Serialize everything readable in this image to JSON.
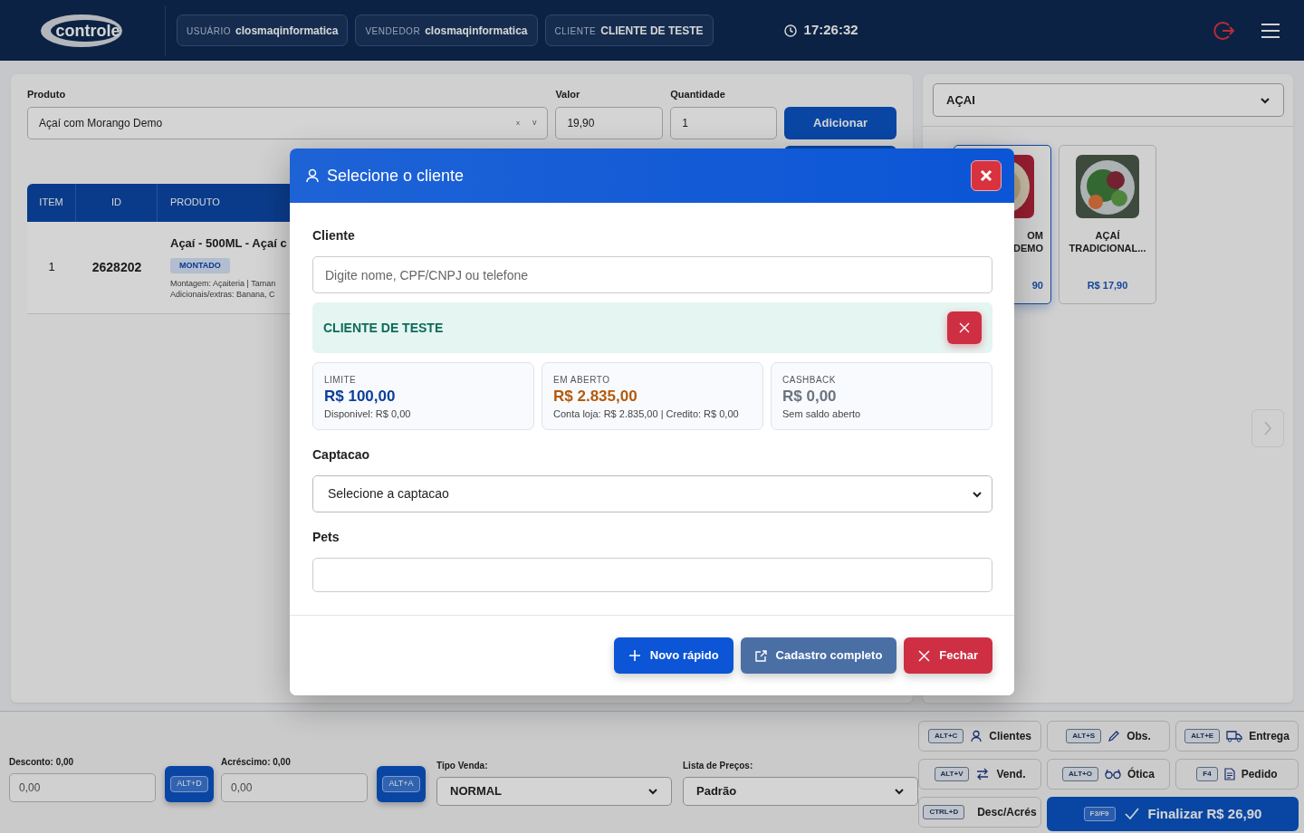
{
  "header": {
    "logo_text": "controle",
    "chips": [
      {
        "label": "USUÁRIO",
        "value": "closmaqinformatica"
      },
      {
        "label": "VENDEDOR",
        "value": "closmaqinformatica"
      },
      {
        "label": "CLIENTE",
        "value": "CLIENTE DE TESTE"
      }
    ],
    "clock": "17:26:32"
  },
  "product_form": {
    "produto_label": "Produto",
    "produto_value": "Açaí com Morango Demo",
    "clear_glyph": "x",
    "caret_glyph": "v",
    "valor_label": "Valor",
    "valor_value": "19,90",
    "quantidade_label": "Quantidade",
    "quantidade_value": "1",
    "add_button": "Adicionar"
  },
  "items_table": {
    "columns": [
      "ITEM",
      "ID",
      "PRODUTO"
    ],
    "rows": [
      {
        "item": "1",
        "id": "2628202",
        "produto": "Açaí - 500ML - Açaí c",
        "badge": "MONTADO",
        "details": [
          "Montagem: Açaiteria | Taman",
          "Adicionais/extras: Banana, C"
        ]
      }
    ]
  },
  "catalog": {
    "category": "AÇAI",
    "products": [
      {
        "name_lines": [
          "OM",
          "DEMO"
        ],
        "price": "90",
        "selected": true
      },
      {
        "name_lines": [
          "AÇAÍ",
          "TRADICIONAL..."
        ],
        "price": "R$ 17,90",
        "selected": false
      }
    ]
  },
  "modal": {
    "title": "Selecione o cliente",
    "cliente_label": "Cliente",
    "search_placeholder": "Digite nome, CPF/CNPJ ou telefone",
    "selected_client": "CLIENTE DE TESTE",
    "stats": [
      {
        "label": "LIMITE",
        "value": "R$ 100,00",
        "note": "Disponivel: R$ 0,00",
        "kind": "primary"
      },
      {
        "label": "EM ABERTO",
        "value": "R$ 2.835,00",
        "note": "Conta loja: R$ 2.835,00 | Credito: R$ 0,00",
        "kind": "warning"
      },
      {
        "label": "CASHBACK",
        "value": "R$ 0,00",
        "note": "Sem saldo aberto",
        "kind": "muted"
      }
    ],
    "captacao_label": "Captacao",
    "captacao_value": "Selecione a captacao",
    "pets_label": "Pets",
    "buttons": [
      {
        "label": "Novo rápido",
        "kind": "new"
      },
      {
        "label": "Cadastro completo",
        "kind": "full"
      },
      {
        "label": "Fechar",
        "kind": "close"
      }
    ]
  },
  "footer": {
    "desconto_label": "Desconto: 0,00",
    "desconto_value": "0,00",
    "desconto_key": "ALT+D",
    "acrescimo_label": "Acréscimo: 0,00",
    "acrescimo_value": "0,00",
    "acrescimo_key": "ALT+A",
    "tipo_venda_label": "Tipo Venda:",
    "tipo_venda_value": "NORMAL",
    "lista_label": "Lista de Preços:",
    "lista_value": "Padrão",
    "actions": [
      {
        "key": "ALT+C",
        "label": "Clientes",
        "kind": "person"
      },
      {
        "key": "ALT+S",
        "label": "Obs.",
        "kind": "pencil"
      },
      {
        "key": "ALT+E",
        "label": "Entrega",
        "kind": "truck"
      },
      {
        "key": "ALT+V",
        "label": "Vend.",
        "kind": "swap"
      },
      {
        "key": "ALT+O",
        "label": "Ótica",
        "kind": "glasses"
      },
      {
        "key": "F4",
        "label": "Pedido",
        "kind": "document"
      },
      {
        "key": "CTRL+D",
        "label": "Desc/Acrés",
        "kind": "money"
      }
    ],
    "finalize": {
      "key": "F3/F9",
      "label": "Finalizar R$ 26,90"
    }
  }
}
